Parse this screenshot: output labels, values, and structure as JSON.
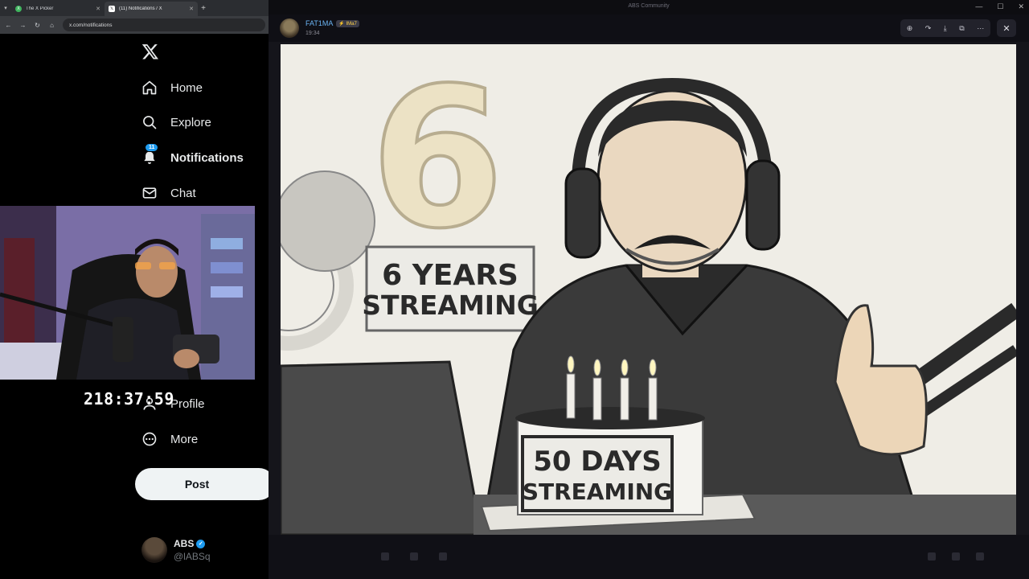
{
  "browser": {
    "tabs": [
      {
        "title": "The X Picker",
        "favicon": "picker-icon",
        "active": false
      },
      {
        "title": "(11) Notifications / X",
        "favicon": "x-logo-icon",
        "active": true
      }
    ],
    "url": "x.com/notifications"
  },
  "sidebar": {
    "items": [
      {
        "label": "Home",
        "icon": "home-icon"
      },
      {
        "label": "Explore",
        "icon": "search-icon"
      },
      {
        "label": "Notifications",
        "icon": "bell-icon",
        "badge": "11",
        "bold": true
      },
      {
        "label": "Chat",
        "icon": "mail-icon"
      },
      {
        "label": "Profile",
        "icon": "person-icon"
      },
      {
        "label": "More",
        "icon": "more-circle-icon"
      }
    ],
    "post_label": "Post",
    "account": {
      "display_name": "ABS",
      "handle": "@lABSq"
    }
  },
  "stream": {
    "timer": "218:37:59"
  },
  "viewer": {
    "title": "ABS Community",
    "sender": "FAT1MA",
    "sender_tag": "⚡ IMa7",
    "time": "19:34",
    "image": {
      "balloon_number": "6",
      "sign_line1": "6 YEARS",
      "sign_line2": "STREAMING",
      "cake_line1": "50 DAYS",
      "cake_line2": "STREAMING"
    }
  },
  "colors": {
    "accent": "#1d9bf0",
    "link": "#6ab3f3",
    "post_button": "#eff3f4"
  }
}
